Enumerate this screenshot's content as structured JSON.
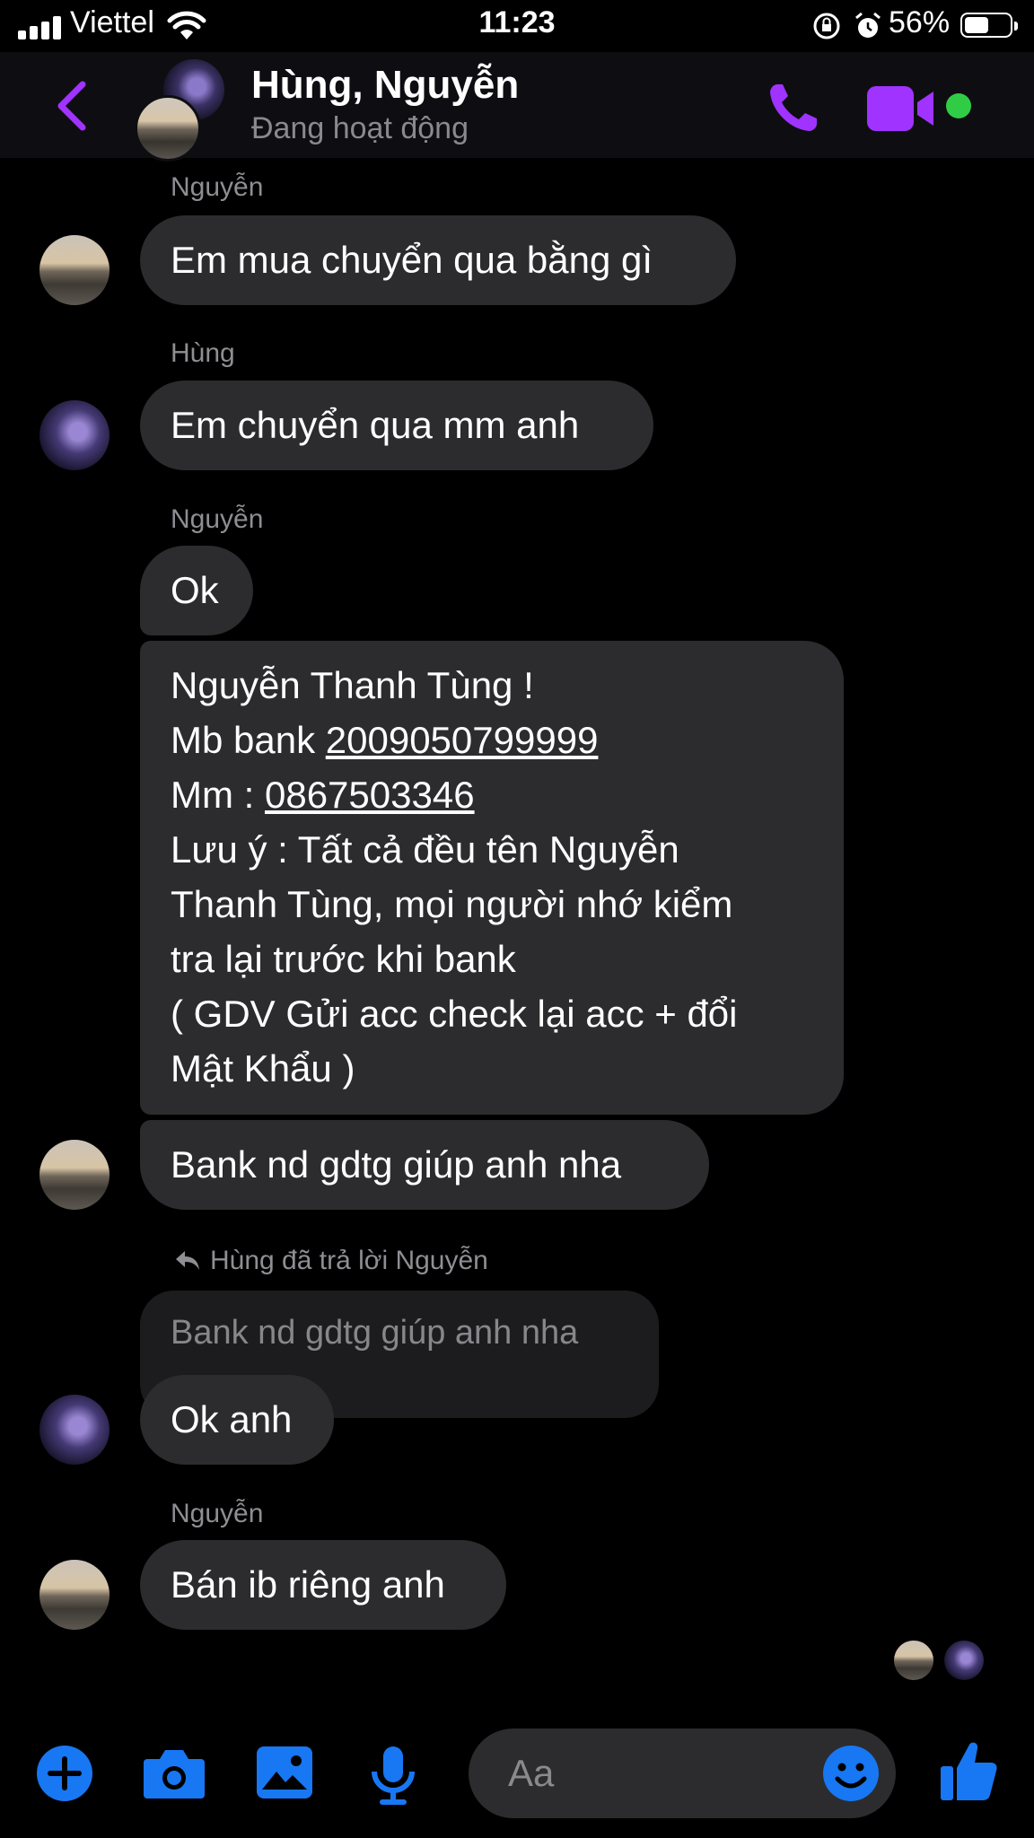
{
  "status_bar": {
    "carrier": "Viettel",
    "time": "11:23",
    "battery": "56%"
  },
  "header": {
    "name": "Hùng, Nguyễn",
    "status": "Đang hoạt động"
  },
  "messages": [
    {
      "sender": "Nguyễn",
      "text": "Em mua chuyển qua bằng gì"
    },
    {
      "sender": "Hùng",
      "text": "Em chuyển qua mm anh"
    },
    {
      "sender": "Nguyễn",
      "text": "Ok"
    },
    {
      "line1": "Nguyễn Thanh Tùng !",
      "line2_label": "Mb bank ",
      "line2_value": "2009050799999",
      "line3_label": "Mm : ",
      "line3_value": "0867503346",
      "line4": "Lưu ý : Tất cả đều tên Nguyễn",
      "line5": "Thanh Tùng, mọi người nhớ kiểm",
      "line6": "tra lại trước khi bank",
      "line7": "( GDV Gửi acc check lại acc + đổi",
      "line8": "Mật Khẩu )"
    },
    {
      "text": "Bank nd gdtg giúp anh nha"
    },
    {
      "reply_label": "Hùng đã trả lời Nguyễn",
      "quoted": "Bank nd gdtg giúp anh nha",
      "text": "Ok anh"
    },
    {
      "sender": "Nguyễn",
      "text": "Bán ib riêng anh"
    }
  ],
  "composer": {
    "placeholder": "Aa"
  },
  "icons": [
    "back-icon",
    "phone-icon",
    "video-icon",
    "plus-icon",
    "camera-icon",
    "gallery-icon",
    "microphone-icon",
    "emoji-icon",
    "thumbs-up-icon"
  ],
  "colors": {
    "accent_purple": "#a033ff",
    "accent_blue": "#1877f2",
    "online_green": "#31cc46",
    "bubble": "#2c2c2e"
  }
}
